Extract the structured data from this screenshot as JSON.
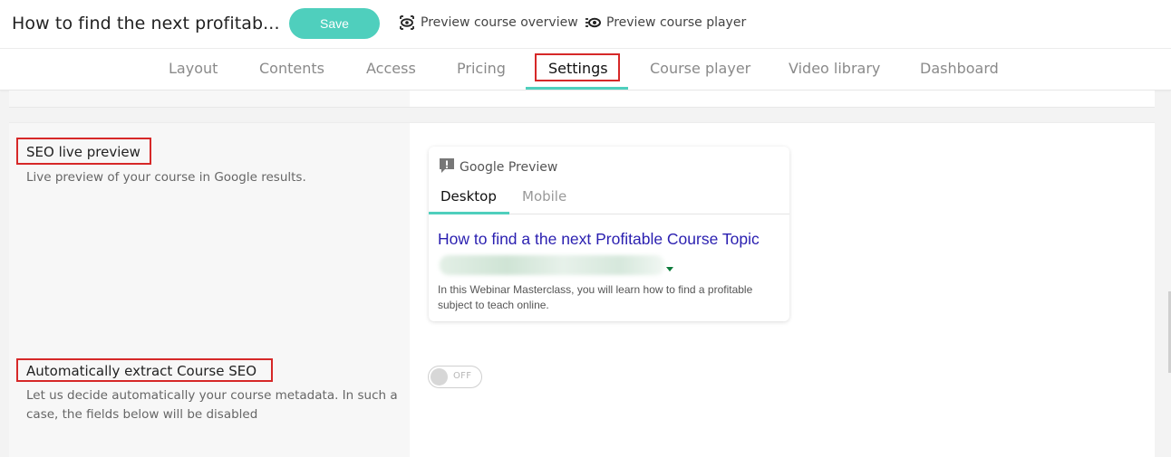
{
  "header": {
    "course_title": "How to find the next profitab...",
    "save_label": "Save",
    "preview_overview_label": "Preview course overview",
    "preview_player_label": "Preview course player",
    "preview_overview_icon": "eye-preview-icon",
    "preview_player_icon": "player-preview-icon"
  },
  "tabs": [
    {
      "label": "Layout"
    },
    {
      "label": "Contents"
    },
    {
      "label": "Access"
    },
    {
      "label": "Pricing"
    },
    {
      "label": "Settings",
      "active": true
    },
    {
      "label": "Course player"
    },
    {
      "label": "Video library"
    },
    {
      "label": "Dashboard"
    }
  ],
  "seo_preview": {
    "title": "SEO live preview",
    "description": "Live preview of your course in Google results.",
    "card": {
      "header_label": "Google Preview",
      "header_icon": "alert-comment-icon",
      "tab_desktop": "Desktop",
      "tab_mobile": "Mobile",
      "result_title": "How to find a the next Profitable Course Topic",
      "result_description": "In this Webinar Masterclass, you will learn how to find a profitable subject to teach online."
    }
  },
  "auto_extract": {
    "title": "Automatically extract Course SEO",
    "description": "Let us decide automatically your course metadata. In such a case, the fields below will be disabled",
    "toggle_label": "OFF",
    "toggle_on": false
  },
  "colors": {
    "accent": "#4fcfbd",
    "highlight": "#d62828",
    "link_blue": "#2a1fb0"
  }
}
